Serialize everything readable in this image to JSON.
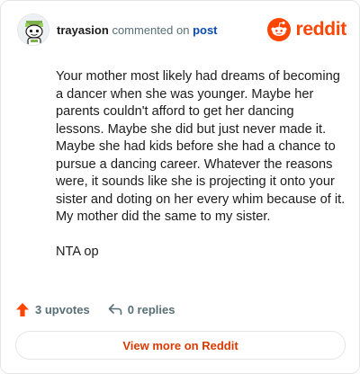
{
  "header": {
    "username": "trayasion",
    "action_text": "commented on",
    "target_link": "post",
    "brand_name": "reddit"
  },
  "comment": {
    "paragraphs": [
      "Your mother most likely had dreams of becoming a dancer when she was younger. Maybe her parents couldn't afford to get her dancing lessons. Maybe she did but just never made it. Maybe she had kids before she had a chance to pursue a dancing career. Whatever the reasons were, it sounds like she is projecting it onto your sister and doting on her every whim because of it. My mother did the same to my sister.",
      "NTA op"
    ]
  },
  "stats": {
    "upvotes": "3 upvotes",
    "replies": "0 replies"
  },
  "cta": {
    "label": "View more on Reddit"
  },
  "colors": {
    "brand_orange": "#ff4500",
    "link_blue": "#0a4bb4",
    "muted": "#576f76",
    "cta_red": "#d93a00"
  },
  "icons": {
    "avatar": "snoo-avatar",
    "logo": "reddit-snoo-logo",
    "upvote": "upvote-arrow-icon",
    "reply": "reply-arrow-icon"
  }
}
